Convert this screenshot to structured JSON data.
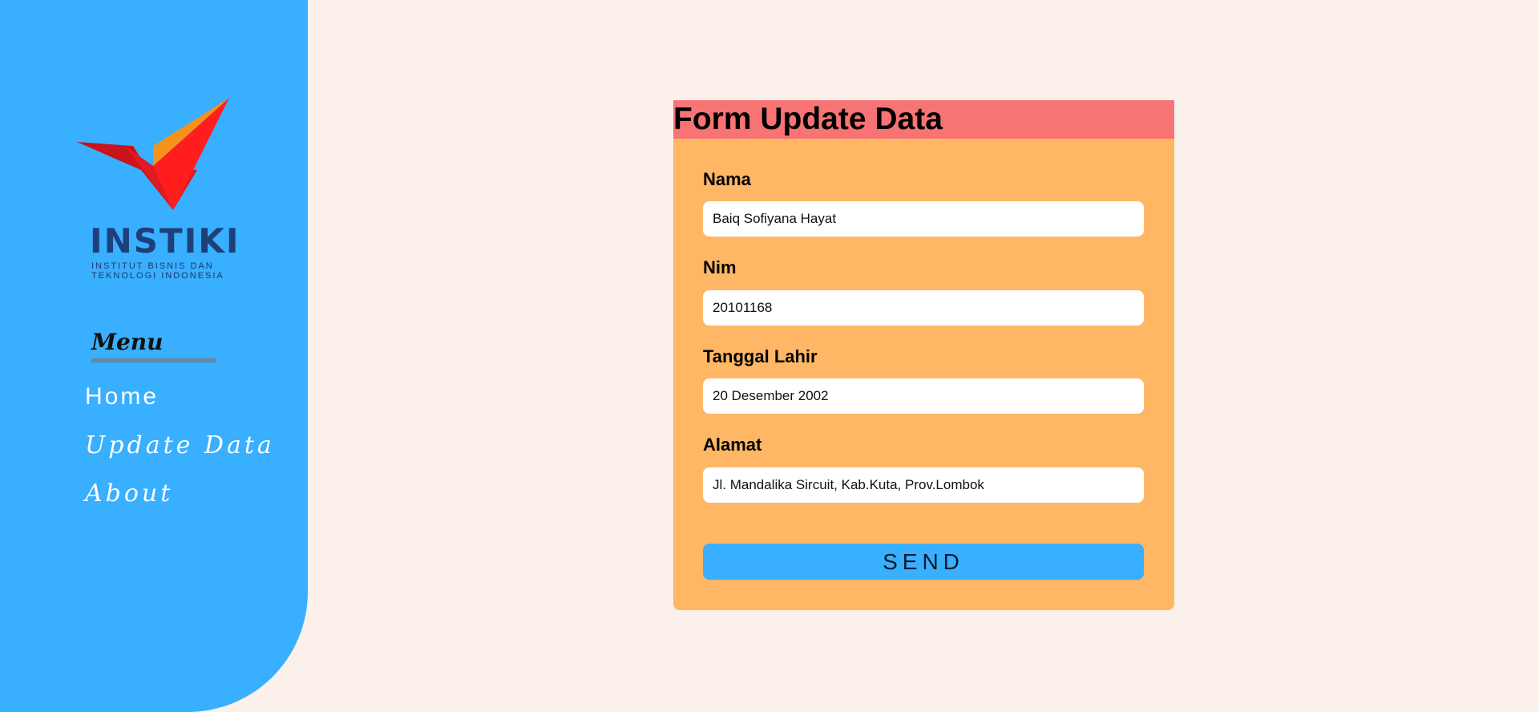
{
  "sidebar": {
    "logo": {
      "name": "INSTIKI",
      "subtitle_line1": "INSTITUT BISNIS DAN",
      "subtitle_line2": "TEKNOLOGI INDONESIA"
    },
    "menu_title": "Menu",
    "nav": [
      {
        "label": "Home"
      },
      {
        "label": "Update Data"
      },
      {
        "label": "About"
      }
    ]
  },
  "form": {
    "title": "Form Update Data",
    "fields": [
      {
        "label": "Nama",
        "value": "Baiq Sofiyana Hayat"
      },
      {
        "label": "Nim",
        "value": "20101168"
      },
      {
        "label": "Tanggal Lahir",
        "value": "20 Desember 2002"
      },
      {
        "label": "Alamat",
        "value": "Jl. Mandalika Sircuit, Kab.Kuta, Prov.Lombok"
      }
    ],
    "send_label": "SEND"
  },
  "colors": {
    "sidebar": "#38afff",
    "background": "#fbf0ea",
    "form_card": "#ffb766",
    "form_header": "#f87474"
  }
}
